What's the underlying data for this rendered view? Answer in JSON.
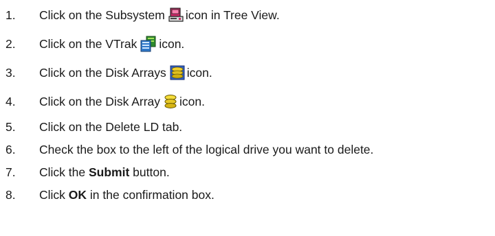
{
  "steps": [
    {
      "num": "1.",
      "before": "Click on the Subsystem",
      "icon": "subsystem-icon",
      "after": "icon in Tree View."
    },
    {
      "num": "2.",
      "before": "Click on the VTrak",
      "icon": "vtrak-icon",
      "after": "icon."
    },
    {
      "num": "3.",
      "before": "Click on the Disk Arrays",
      "icon": "disk-arrays-icon",
      "after": "icon."
    },
    {
      "num": "4.",
      "before": "Click on the Disk Array",
      "icon": "disk-array-icon",
      "after": "icon."
    },
    {
      "num": "5.",
      "text": "Click on the Delete LD tab."
    },
    {
      "num": "6.",
      "text": "Check the box to the left of the logical drive you want to delete."
    },
    {
      "num": "7.",
      "before": "Click the",
      "bold": "Submit",
      "after": "button."
    },
    {
      "num": "8.",
      "before": "Click",
      "bold": "OK",
      "after": "in the confirmation box."
    }
  ]
}
